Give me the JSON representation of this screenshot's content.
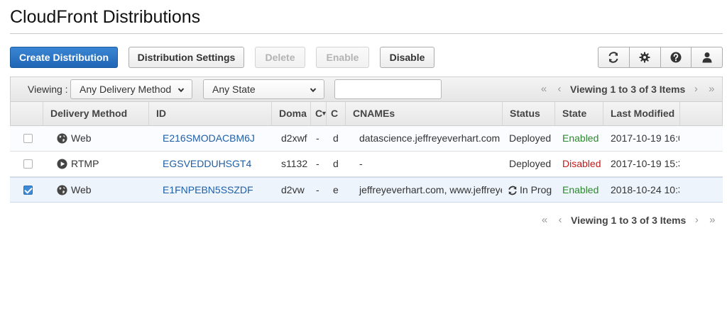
{
  "page": {
    "title": "CloudFront Distributions"
  },
  "toolbar": {
    "create_label": "Create Distribution",
    "settings_label": "Distribution Settings",
    "delete_label": "Delete",
    "enable_label": "Enable",
    "disable_label": "Disable",
    "icons": [
      "refresh-icon",
      "gear-icon",
      "help-icon",
      "user-icon"
    ]
  },
  "filter": {
    "viewing_label": "Viewing :",
    "delivery_method_selected": "Any Delivery Method",
    "state_selected": "Any State",
    "search_value": "",
    "pager_text": "Viewing 1 to 3 of 3 Items"
  },
  "table": {
    "headers": {
      "delivery_method": "Delivery Method",
      "id": "ID",
      "domain": "Doma",
      "col_c1": "C",
      "col_c2": "C",
      "cnames": "CNAMEs",
      "status": "Status",
      "state": "State",
      "last_modified": "Last Modified"
    },
    "rows": [
      {
        "checked": false,
        "delivery_method": "Web",
        "delivery_icon": "globe-icon",
        "id": "E216SMODACBM6J",
        "domain": "d2xwf",
        "c1": "-",
        "c2": "d",
        "cnames": "datascience.jeffreyeverhart.com",
        "status": "Deployed",
        "state": "Enabled",
        "last_modified": "2017-10-19 16:0"
      },
      {
        "checked": false,
        "delivery_method": "RTMP",
        "delivery_icon": "play-icon",
        "id": "EGSVEDDUHSGT4",
        "domain": "s1132",
        "c1": "-",
        "c2": "d",
        "cnames": "-",
        "status": "Deployed",
        "state": "Disabled",
        "last_modified": "2017-10-19 15:3"
      },
      {
        "checked": true,
        "delivery_method": "Web",
        "delivery_icon": "globe-icon",
        "id": "E1FNPEBN5SSZDF",
        "domain": "d2vw",
        "c1": "-",
        "c2": "e",
        "cnames": "jeffreyeverhart.com, www.jeffreye",
        "status": "In Prog",
        "state": "Enabled",
        "last_modified": "2018-10-24 10:3"
      }
    ]
  },
  "footer": {
    "pager_text": "Viewing 1 to 3 of 3 Items"
  },
  "colors": {
    "primary": "#1f66b5",
    "link": "#1d5fa8",
    "enabled": "#2b8a2b",
    "disabled": "#c21b1b"
  }
}
